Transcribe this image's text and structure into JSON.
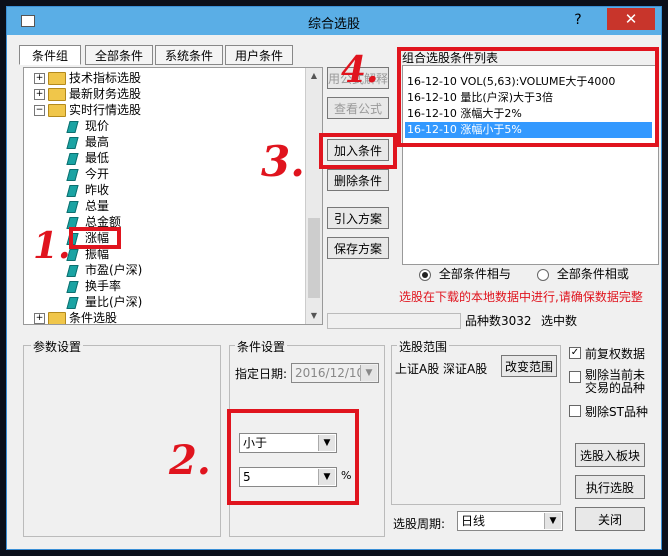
{
  "window": {
    "title": "综合选股",
    "help_glyph": "?",
    "close_glyph": "✕"
  },
  "tabs": [
    {
      "label": "条件组",
      "active": true
    },
    {
      "label": "全部条件",
      "active": false
    },
    {
      "label": "系统条件",
      "active": false
    },
    {
      "label": "用户条件",
      "active": false
    }
  ],
  "tree": {
    "folders": [
      "技术指标选股",
      "最新财务选股",
      "实时行情选股",
      "条件选股"
    ],
    "leaves": [
      "现价",
      "最高",
      "最低",
      "今开",
      "昨收",
      "总量",
      "总金额",
      "涨幅",
      "振幅",
      "市盈(户深)",
      "换手率",
      "量比(户深)"
    ],
    "selected_leaf": "涨幅"
  },
  "middle_buttons": {
    "use_formula": "用公式解释",
    "view_formula": "查看公式",
    "add_condition": "加入条件",
    "delete_condition": "删除条件",
    "import_plan": "引入方案",
    "save_plan": "保存方案"
  },
  "condition_list": {
    "title": "组合选股条件列表",
    "items": [
      "16-12-10 VOL(5,63):VOLUME大于4000",
      "16-12-10 量比(户深)大于3倍",
      "16-12-10 涨幅大于2%",
      "16-12-10 涨幅小于5%"
    ],
    "selected_index": 3
  },
  "logic": {
    "and_label": "全部条件相与",
    "or_label": "全部条件相或",
    "selected": "and",
    "notice": "选股在下载的本地数据中进行,请确保数据完整",
    "notice_color": "#e0141e"
  },
  "stats": {
    "count_label": "品种数",
    "count_value": "3032",
    "selected_label": "选中数",
    "selected_value": ""
  },
  "param_group": {
    "label": "参数设置"
  },
  "condition_settings": {
    "label": "条件设置",
    "date_label": "指定日期:",
    "date_value": "2016/12/10",
    "operator": "小于",
    "value": "5",
    "unit": "%"
  },
  "range_group": {
    "label": "选股范围",
    "range_text": "上证A股 深证A股",
    "change_button": "改变范围"
  },
  "options": {
    "adjusted_data": {
      "label": "前复权数据",
      "checked": true
    },
    "exclude_suspended": {
      "label": "剔除当前未交易的品种",
      "checked": false
    },
    "exclude_st": {
      "label": "剔除ST品种",
      "checked": false
    }
  },
  "actions": {
    "select_to_block": "选股入板块",
    "execute": "执行选股",
    "close": "关闭"
  },
  "period": {
    "label": "选股周期:",
    "value": "日线"
  },
  "annotations": [
    "1.",
    "2.",
    "3.",
    "4."
  ]
}
